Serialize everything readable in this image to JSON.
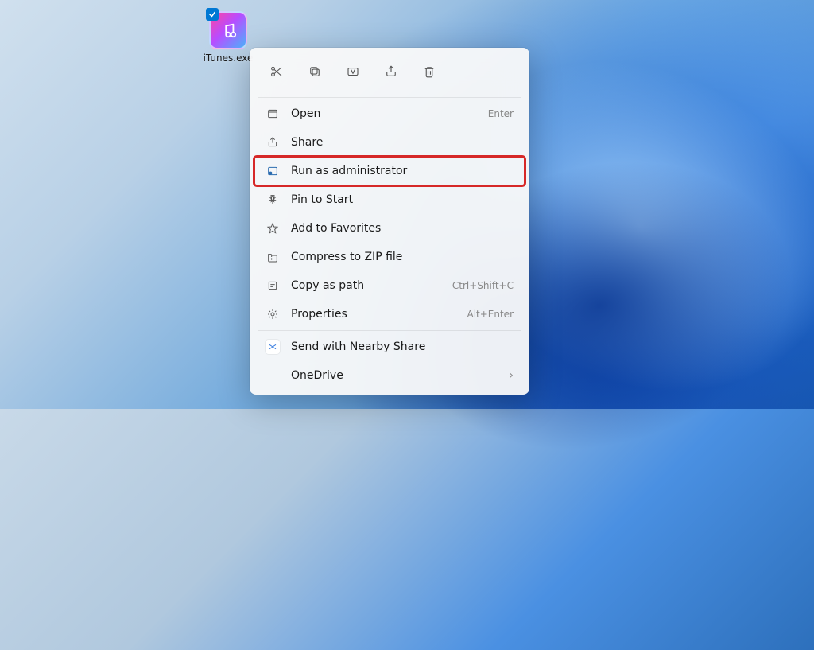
{
  "desktop": {
    "icon_label": "iTunes.exe"
  },
  "context_menu": {
    "items": [
      {
        "label": "Open",
        "shortcut": "Enter"
      },
      {
        "label": "Share",
        "shortcut": ""
      },
      {
        "label": "Run as administrator",
        "shortcut": ""
      },
      {
        "label": "Pin to Start",
        "shortcut": ""
      },
      {
        "label": "Add to Favorites",
        "shortcut": ""
      },
      {
        "label": "Compress to ZIP file",
        "shortcut": ""
      },
      {
        "label": "Copy as path",
        "shortcut": "Ctrl+Shift+C"
      },
      {
        "label": "Properties",
        "shortcut": "Alt+Enter"
      },
      {
        "label": "Send with Nearby Share",
        "shortcut": ""
      },
      {
        "label": "OneDrive",
        "shortcut": ""
      }
    ],
    "highlighted_index": 2
  }
}
